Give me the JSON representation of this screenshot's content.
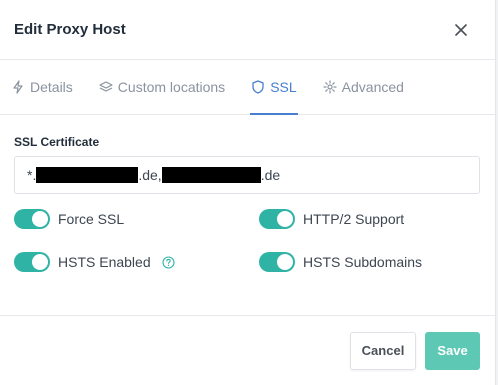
{
  "modal": {
    "title": "Edit Proxy Host",
    "close_icon": "close-icon"
  },
  "tabs": [
    {
      "label": "Details",
      "icon": "bolt-icon",
      "active": false
    },
    {
      "label": "Custom locations",
      "icon": "layers-icon",
      "active": false
    },
    {
      "label": "SSL",
      "icon": "shield-icon",
      "active": true
    },
    {
      "label": "Advanced",
      "icon": "gear-icon",
      "active": false
    }
  ],
  "ssl": {
    "certificate_label": "SSL Certificate",
    "certificate_parts": [
      "*.",
      ".de, ",
      ".de"
    ]
  },
  "toggles": [
    {
      "label": "Force SSL",
      "on": true
    },
    {
      "label": "HTTP/2 Support",
      "on": true
    },
    {
      "label": "HSTS Enabled",
      "on": true,
      "help_icon": "help-circle-icon"
    },
    {
      "label": "HSTS Subdomains",
      "on": true
    }
  ],
  "footer": {
    "cancel_label": "Cancel",
    "save_label": "Save"
  },
  "colors": {
    "accent": "#467fcf",
    "toggle_on": "#2fb3a4",
    "save_button": "#5dc9b5"
  }
}
